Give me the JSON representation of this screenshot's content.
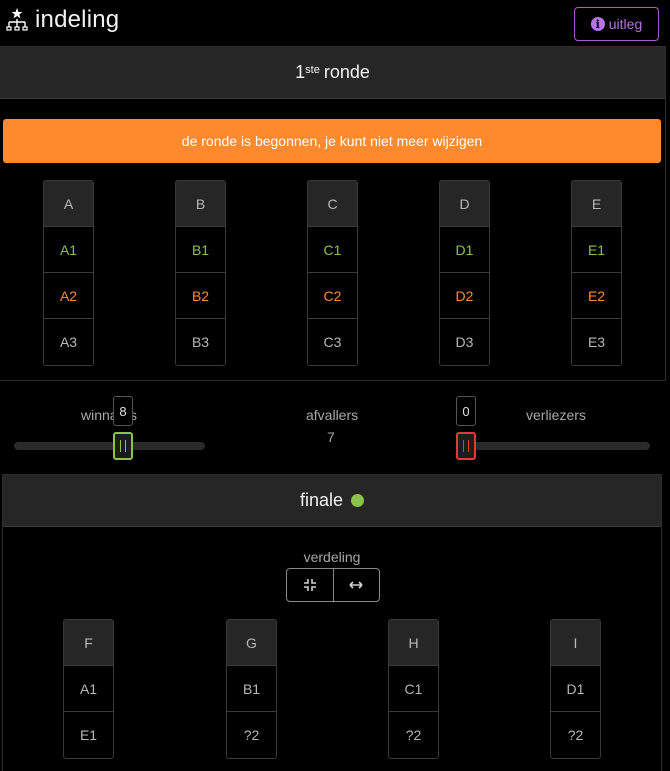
{
  "header": {
    "app_icon": "bracket-tree-icon",
    "title": "indeling",
    "help_icon": "info-icon",
    "help_label": "uitleg"
  },
  "round": {
    "title_sup": "ste",
    "title_num": "1",
    "title_text": "ronde",
    "alert": "de ronde is begonnen, je kunt niet meer wijzigen",
    "groups": [
      {
        "name": "A",
        "cells": [
          "A1",
          "A2",
          "A3"
        ]
      },
      {
        "name": "B",
        "cells": [
          "B1",
          "B2",
          "B3"
        ]
      },
      {
        "name": "C",
        "cells": [
          "C1",
          "C2",
          "C3"
        ]
      },
      {
        "name": "D",
        "cells": [
          "D1",
          "D2",
          "D3"
        ]
      },
      {
        "name": "E",
        "cells": [
          "E1",
          "E2",
          "E3"
        ]
      }
    ]
  },
  "sliders": {
    "winners": {
      "label": "winnaars",
      "value": "8"
    },
    "afvallers": {
      "label": "afvallers",
      "value": "7"
    },
    "losers": {
      "label": "verliezers",
      "value": "0"
    }
  },
  "finale": {
    "title": "finale",
    "status_color": "#8bc34a",
    "verdeling_label": "verdeling",
    "seg_compress_icon": "compress-icon",
    "seg_expand_icon": "arrows-horizontal-icon",
    "groups": [
      {
        "name": "F",
        "cells": [
          "A1",
          "E1"
        ]
      },
      {
        "name": "G",
        "cells": [
          "B1",
          "?2"
        ]
      },
      {
        "name": "H",
        "cells": [
          "C1",
          "?2"
        ]
      },
      {
        "name": "I",
        "cells": [
          "D1",
          "?2"
        ]
      }
    ]
  },
  "colors": {
    "accent_purple": "#b673e6",
    "alert_orange": "#ff8a2e",
    "winner_green": "#8bc34a",
    "loser_red": "#e53935"
  }
}
